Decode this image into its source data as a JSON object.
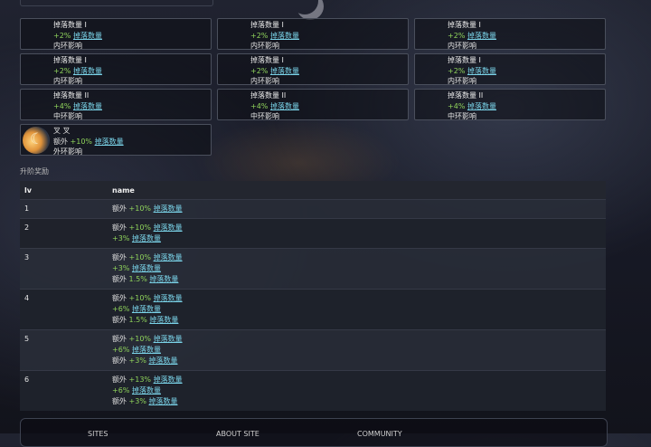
{
  "cards": [
    {
      "title": "掉落数量 I",
      "pre": "",
      "value": "+2%",
      "stat": "掉落数量",
      "scope": "内环影响",
      "icon": "green-crystal-icon"
    },
    {
      "title": "掉落数量 I",
      "pre": "",
      "value": "+2%",
      "stat": "掉落数量",
      "scope": "内环影响",
      "icon": "green-crystal-icon"
    },
    {
      "title": "掉落数量 I",
      "pre": "",
      "value": "+2%",
      "stat": "掉落数量",
      "scope": "内环影响",
      "icon": "green-crystal-icon"
    },
    {
      "title": "掉落数量 I",
      "pre": "",
      "value": "+2%",
      "stat": "掉落数量",
      "scope": "内环影响",
      "icon": "green-crystal-icon"
    },
    {
      "title": "掉落数量 I",
      "pre": "",
      "value": "+2%",
      "stat": "掉落数量",
      "scope": "内环影响",
      "icon": "green-crystal-icon"
    },
    {
      "title": "掉落数量 I",
      "pre": "",
      "value": "+2%",
      "stat": "掉落数量",
      "scope": "内环影响",
      "icon": "green-crystal-icon"
    },
    {
      "title": "掉落数量 II",
      "pre": "",
      "value": "+4%",
      "stat": "掉落数量",
      "scope": "中环影响",
      "icon": "green-crystal-icon"
    },
    {
      "title": "掉落数量 II",
      "pre": "",
      "value": "+4%",
      "stat": "掉落数量",
      "scope": "中环影响",
      "icon": "green-crystal-icon"
    },
    {
      "title": "掉落数量 II",
      "pre": "",
      "value": "+4%",
      "stat": "掉落数量",
      "scope": "中环影响",
      "icon": "green-crystal-icon"
    },
    {
      "title": "叉 叉",
      "pre": "额外 ",
      "value": "+10%",
      "stat": "掉落数量",
      "scope": "外环影响",
      "icon": "moon-emblem-icon"
    }
  ],
  "section_label": "升阶奖励",
  "table": {
    "headers": [
      "lv",
      "name"
    ],
    "rows": [
      {
        "lv": "1",
        "lines": [
          {
            "pre": "额外 ",
            "value": "+10%",
            "stat": "掉落数量"
          }
        ]
      },
      {
        "lv": "2",
        "lines": [
          {
            "pre": "额外 ",
            "value": "+10%",
            "stat": "掉落数量"
          },
          {
            "pre": "",
            "value": "+3%",
            "stat": "掉落数量"
          }
        ]
      },
      {
        "lv": "3",
        "lines": [
          {
            "pre": "额外 ",
            "value": "+10%",
            "stat": "掉落数量"
          },
          {
            "pre": "",
            "value": "+3%",
            "stat": "掉落数量"
          },
          {
            "pre": "额外 ",
            "value": "1.5%",
            "stat": "掉落数量"
          }
        ]
      },
      {
        "lv": "4",
        "lines": [
          {
            "pre": "额外 ",
            "value": "+10%",
            "stat": "掉落数量"
          },
          {
            "pre": "",
            "value": "+6%",
            "stat": "掉落数量"
          },
          {
            "pre": "额外 ",
            "value": "1.5%",
            "stat": "掉落数量"
          }
        ]
      },
      {
        "lv": "5",
        "lines": [
          {
            "pre": "额外 ",
            "value": "+10%",
            "stat": "掉落数量"
          },
          {
            "pre": "",
            "value": "+6%",
            "stat": "掉落数量"
          },
          {
            "pre": "额外 ",
            "value": "+3%",
            "stat": "掉落数量"
          }
        ]
      },
      {
        "lv": "6",
        "lines": [
          {
            "pre": "额外 ",
            "value": "+13%",
            "stat": "掉落数量"
          },
          {
            "pre": "",
            "value": "+6%",
            "stat": "掉落数量"
          },
          {
            "pre": "额外 ",
            "value": "+3%",
            "stat": "掉落数量"
          }
        ]
      }
    ]
  },
  "footer": {
    "col1": "SITES",
    "col2": "ABOUT SITE",
    "col3": "COMMUNITY"
  }
}
